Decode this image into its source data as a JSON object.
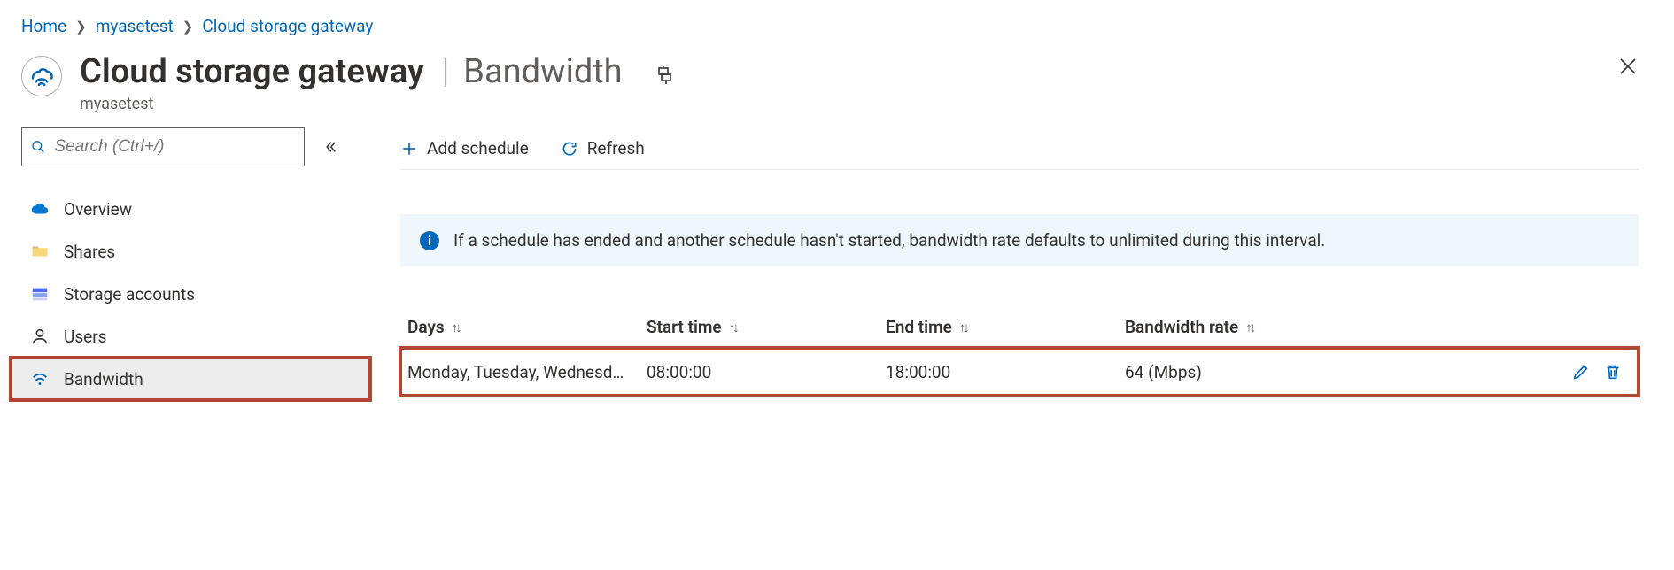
{
  "breadcrumb": {
    "items": [
      "Home",
      "myasetest",
      "Cloud storage gateway"
    ]
  },
  "header": {
    "title": "Cloud storage gateway",
    "section": "Bandwidth",
    "subtitle": "myasetest"
  },
  "sidebar": {
    "search_placeholder": "Search (Ctrl+/)",
    "items": [
      {
        "id": "overview",
        "label": "Overview"
      },
      {
        "id": "shares",
        "label": "Shares"
      },
      {
        "id": "storage-accounts",
        "label": "Storage accounts"
      },
      {
        "id": "users",
        "label": "Users"
      },
      {
        "id": "bandwidth",
        "label": "Bandwidth"
      }
    ],
    "selected": "bandwidth"
  },
  "commands": {
    "add": "Add schedule",
    "refresh": "Refresh"
  },
  "info": {
    "text": "If a schedule has ended and another schedule hasn't started, bandwidth rate defaults to unlimited during this interval."
  },
  "table": {
    "columns": {
      "days": "Days",
      "start": "Start time",
      "end": "End time",
      "rate": "Bandwidth rate"
    },
    "rows": [
      {
        "days": "Monday, Tuesday, Wednesd…",
        "start": "08:00:00",
        "end": "18:00:00",
        "rate": "64 (Mbps)"
      }
    ]
  },
  "icons": {
    "edit": "edit",
    "delete": "delete"
  }
}
